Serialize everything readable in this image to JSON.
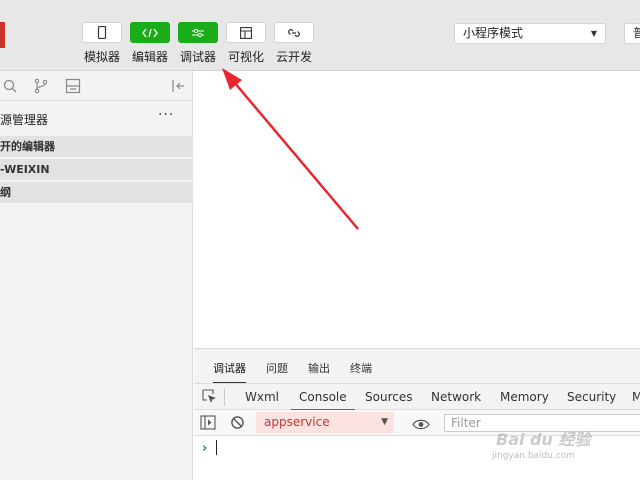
{
  "toolbar": {
    "tools": [
      {
        "label": "模拟器",
        "icon": "phone-icon"
      },
      {
        "label": "编辑器",
        "icon": "code-icon"
      },
      {
        "label": "调试器",
        "icon": "sliders-icon"
      },
      {
        "label": "可视化",
        "icon": "layout-icon"
      },
      {
        "label": "云开发",
        "icon": "cloud-link-icon"
      }
    ],
    "mode_select": "小程序模式",
    "right_button": "普"
  },
  "left_panel": {
    "title": "源管理器",
    "more": "···",
    "sections": [
      "开的编辑器",
      "-WEIXIN",
      "纲"
    ]
  },
  "debugger": {
    "top_tabs": [
      "调试器",
      "问题",
      "输出",
      "终端"
    ],
    "panel_tabs": [
      "Wxml",
      "Console",
      "Sources",
      "Network",
      "Memory",
      "Security",
      "M"
    ],
    "active_panel_tab": "Console",
    "context_select": "appservice",
    "filter_placeholder": "Filter",
    "prompt": "›"
  },
  "watermark": {
    "text": "Bai du 经验",
    "sub": "jingyan.baidu.com"
  },
  "colors": {
    "accent_green": "#1aad19",
    "annotation_red": "#e8262d",
    "active_tab_blue": "#1a73e8"
  }
}
